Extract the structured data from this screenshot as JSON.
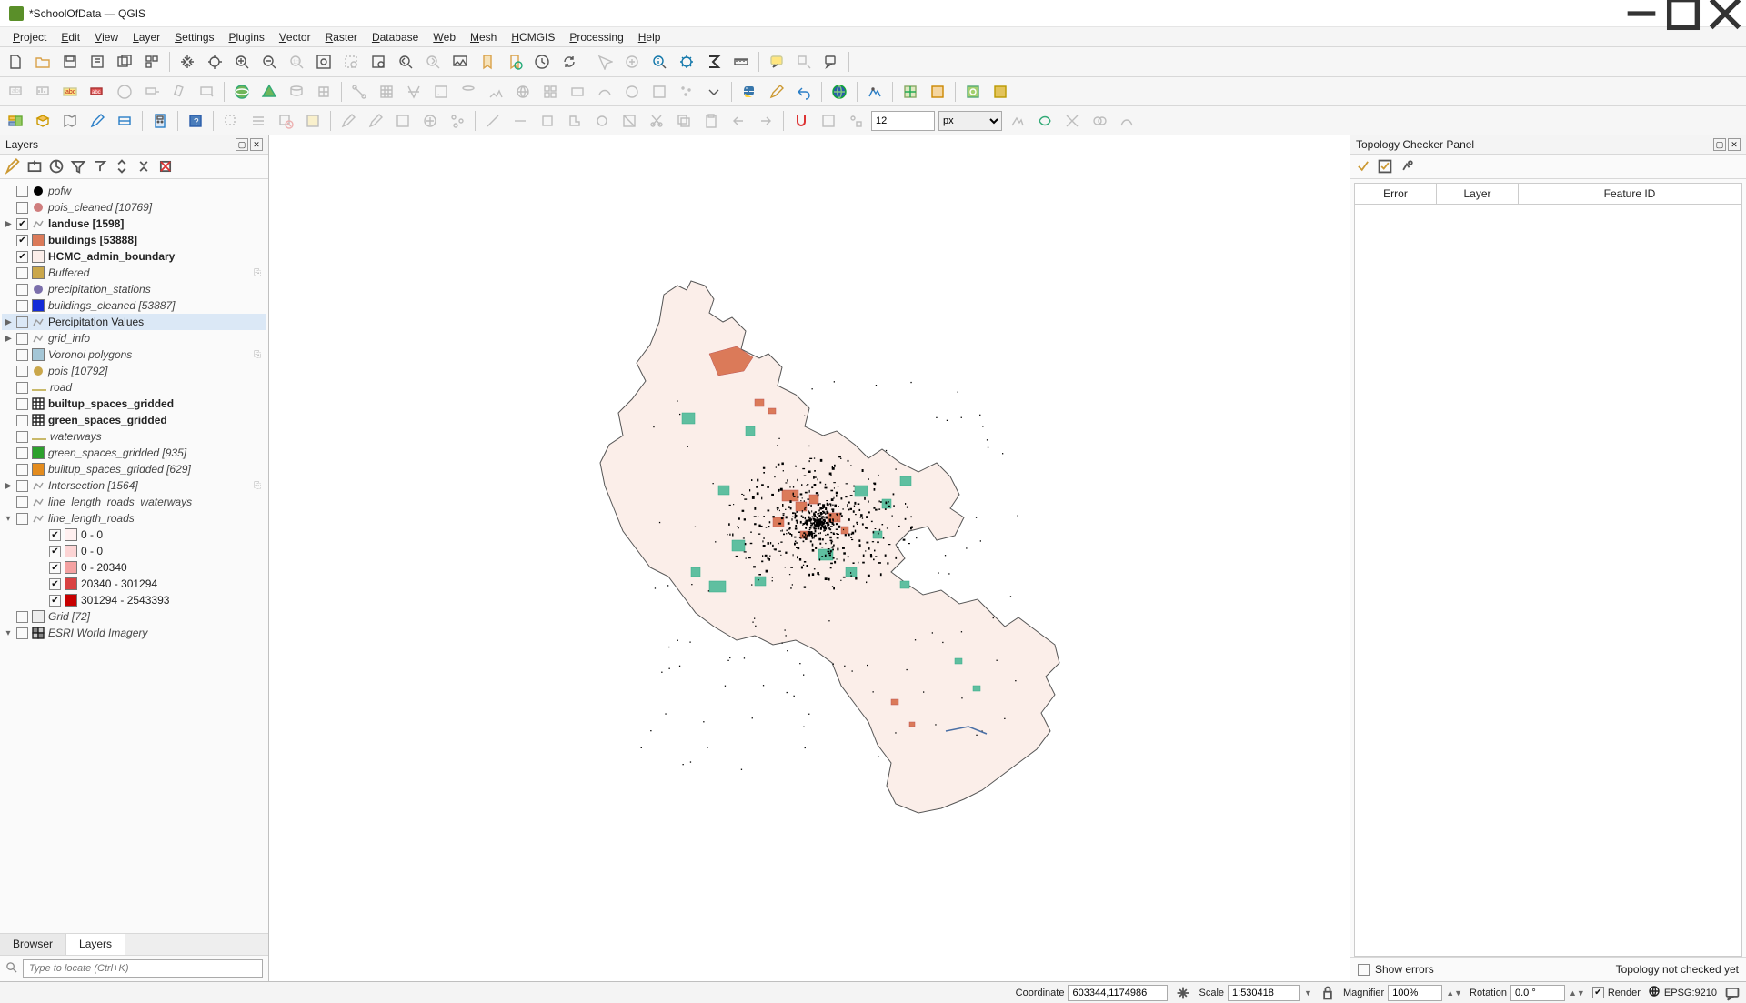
{
  "titlebar": {
    "title": "*SchoolOfData — QGIS"
  },
  "menu": [
    "Project",
    "Edit",
    "View",
    "Layer",
    "Settings",
    "Plugins",
    "Vector",
    "Raster",
    "Database",
    "Web",
    "Mesh",
    "HCMGIS",
    "Processing",
    "Help"
  ],
  "dock": {
    "title": "Layers",
    "tabs": {
      "browser": "Browser",
      "layers": "Layers"
    },
    "locator_placeholder": "Type to locate (Ctrl+K)"
  },
  "layers": [
    {
      "name": "pofw",
      "checked": false,
      "bold": false,
      "italic": true,
      "swatch": "#000",
      "symbol": "dot",
      "indent": 0,
      "toggle": ""
    },
    {
      "name": "pois_cleaned [10769]",
      "checked": false,
      "bold": false,
      "italic": true,
      "swatch": "#cf7d7d",
      "symbol": "dot",
      "indent": 0,
      "toggle": ""
    },
    {
      "name": "landuse [1598]",
      "checked": true,
      "bold": true,
      "swatch": "",
      "symbol": "poly",
      "indent": 0,
      "toggle": "▶"
    },
    {
      "name": "buildings [53888]",
      "checked": true,
      "bold": true,
      "swatch": "#db7a59",
      "symbol": "poly",
      "indent": 0,
      "toggle": ""
    },
    {
      "name": "HCMC_admin_boundary",
      "checked": true,
      "bold": true,
      "swatch": "#fbeee9",
      "symbol": "poly",
      "indent": 0,
      "toggle": ""
    },
    {
      "name": "Buffered",
      "checked": false,
      "italic": true,
      "swatch": "#caa74b",
      "symbol": "poly",
      "indent": 0,
      "toggle": "",
      "memory": true
    },
    {
      "name": "precipitation_stations",
      "checked": false,
      "italic": true,
      "swatch": "#7b6fab",
      "symbol": "dot",
      "indent": 0,
      "toggle": ""
    },
    {
      "name": "buildings_cleaned [53887]",
      "checked": false,
      "italic": true,
      "swatch": "#132bd8",
      "symbol": "poly",
      "indent": 0,
      "toggle": ""
    },
    {
      "name": "Percipitation Values",
      "checked": false,
      "swatch": "",
      "symbol": "poly",
      "indent": 0,
      "toggle": "▶",
      "selected": true
    },
    {
      "name": "grid_info",
      "checked": false,
      "italic": true,
      "swatch": "",
      "symbol": "poly",
      "indent": 0,
      "toggle": "▶"
    },
    {
      "name": "Voronoi polygons",
      "checked": false,
      "italic": true,
      "swatch": "#a4c6d6",
      "symbol": "poly",
      "indent": 0,
      "toggle": "",
      "memory": true
    },
    {
      "name": "pois [10792]",
      "checked": false,
      "italic": true,
      "swatch": "#caa74b",
      "symbol": "dot",
      "indent": 0,
      "toggle": ""
    },
    {
      "name": "road",
      "checked": false,
      "italic": true,
      "swatch": "",
      "symbol": "line",
      "indent": 0,
      "toggle": ""
    },
    {
      "name": "builtup_spaces_gridded",
      "checked": false,
      "bold": true,
      "swatch": "",
      "symbol": "table",
      "indent": 0,
      "toggle": ""
    },
    {
      "name": "green_spaces_gridded",
      "checked": false,
      "bold": true,
      "swatch": "",
      "symbol": "table",
      "indent": 0,
      "toggle": ""
    },
    {
      "name": "waterways",
      "checked": false,
      "italic": true,
      "swatch": "",
      "symbol": "line",
      "indent": 0,
      "toggle": ""
    },
    {
      "name": "green_spaces_gridded [935]",
      "checked": false,
      "italic": true,
      "swatch": "#2ca02c",
      "symbol": "poly",
      "indent": 0,
      "toggle": ""
    },
    {
      "name": "builtup_spaces_gridded [629]",
      "checked": false,
      "italic": true,
      "swatch": "#e38b1d",
      "symbol": "poly",
      "indent": 0,
      "toggle": ""
    },
    {
      "name": "Intersection [1564]",
      "checked": false,
      "italic": true,
      "swatch": "",
      "symbol": "poly",
      "indent": 0,
      "toggle": "▶",
      "memory": true
    },
    {
      "name": "line_length_roads_waterways",
      "checked": false,
      "italic": true,
      "swatch": "",
      "symbol": "poly",
      "indent": 0,
      "toggle": ""
    },
    {
      "name": "line_length_roads",
      "checked": false,
      "italic": true,
      "swatch": "",
      "symbol": "poly",
      "indent": 0,
      "toggle": "▾"
    },
    {
      "name": "0 - 0",
      "checked": true,
      "swatch": "#fff0f0",
      "symbol": "poly",
      "indent": 2,
      "toggle": ""
    },
    {
      "name": "0 - 0",
      "checked": true,
      "swatch": "#fcd4d4",
      "symbol": "poly",
      "indent": 2,
      "toggle": ""
    },
    {
      "name": "0 - 20340",
      "checked": true,
      "swatch": "#f4a1a1",
      "symbol": "poly",
      "indent": 2,
      "toggle": ""
    },
    {
      "name": "20340 - 301294",
      "checked": true,
      "swatch": "#d94242",
      "symbol": "poly",
      "indent": 2,
      "toggle": ""
    },
    {
      "name": "301294 - 2543393",
      "checked": true,
      "swatch": "#c70000",
      "symbol": "poly",
      "indent": 2,
      "toggle": ""
    },
    {
      "name": "Grid [72]",
      "checked": false,
      "italic": true,
      "swatch": "#eee",
      "symbol": "poly",
      "indent": 0,
      "toggle": ""
    },
    {
      "name": "ESRI World Imagery",
      "checked": false,
      "italic": true,
      "swatch": "",
      "symbol": "raster",
      "indent": 0,
      "toggle": "▾"
    }
  ],
  "topology_panel": {
    "title": "Topology Checker Panel",
    "headers": {
      "error": "Error",
      "layer": "Layer",
      "feature_id": "Feature ID"
    },
    "show_errors_label": "Show errors",
    "status": "Topology not checked yet"
  },
  "statusbar": {
    "coordinate_label": "Coordinate",
    "coordinate_value": "603344,1174986",
    "scale_label": "Scale",
    "scale_value": "1:530418",
    "magnifier_label": "Magnifier",
    "magnifier_value": "100%",
    "rotation_label": "Rotation",
    "rotation_value": "0.0 °",
    "render_label": "Render",
    "crs_value": "EPSG:9210"
  },
  "snap_tolerance": "12",
  "snap_unit": "px"
}
